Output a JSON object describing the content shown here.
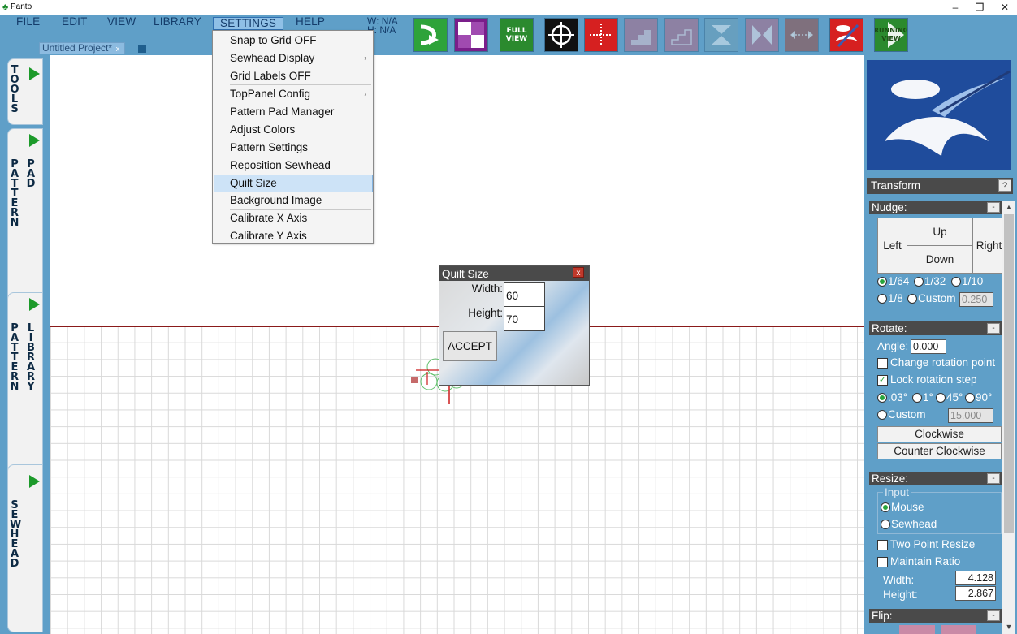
{
  "window": {
    "title": "Panto",
    "minimize": "–",
    "maximize": "❐",
    "close": "✕"
  },
  "menubar": {
    "file": "FILE",
    "edit": "EDIT",
    "view": "VIEW",
    "library": "LIBRARY",
    "settings": "SETTINGS",
    "help": "HELP"
  },
  "coords": {
    "w": "W: N/A",
    "h": "H: N/A"
  },
  "project": {
    "tab_label": "Untitled Project*",
    "tab_close": "x"
  },
  "toolbar": {
    "full_view": "FULL VIEW",
    "running_view": "RUNNING VIEW"
  },
  "sidebar": {
    "tools": "TOOLS",
    "pattern_pad_1": "PATTERN",
    "pattern_pad_2": "PAD",
    "pattern_library_1": "PATTERN",
    "pattern_library_2": "LIBRARY",
    "sewhead": "SEWHEAD"
  },
  "settings_menu": {
    "items": [
      "Snap to Grid OFF",
      "Sewhead Display",
      "Grid Labels OFF",
      "TopPanel Config",
      "Pattern Pad Manager",
      "Adjust Colors",
      "Pattern Settings",
      "Reposition Sewhead",
      "Quilt Size",
      "Background Image",
      "Calibrate X Axis",
      "Calibrate Y Axis"
    ],
    "submenu_arrow": "›"
  },
  "quilt_dialog": {
    "title": "Quilt Size",
    "close": "x",
    "width_label": "Width:",
    "width_value": "60",
    "height_label": "Height:",
    "height_value": "70",
    "accept": "ACCEPT"
  },
  "transform": {
    "title": "Transform",
    "help": "?",
    "nudge": {
      "title": "Nudge:",
      "collapse": "-",
      "up": "Up",
      "down": "Down",
      "left": "Left",
      "right": "Right",
      "opt_1_64": "1/64",
      "opt_1_32": "1/32",
      "opt_1_10": "1/10",
      "opt_1_8": "1/8",
      "opt_custom": "Custom",
      "custom_value": "0.250"
    },
    "rotate": {
      "title": "Rotate:",
      "collapse": "-",
      "angle_label": "Angle:",
      "angle_value": "0.000",
      "change_point": "Change rotation point",
      "lock_step": "Lock rotation step",
      "opt_03": ".03°",
      "opt_1": "1°",
      "opt_45": "45°",
      "opt_90": "90°",
      "opt_custom": "Custom",
      "custom_value": "15.000",
      "clockwise": "Clockwise",
      "counter_clockwise": "Counter Clockwise"
    },
    "resize": {
      "title": "Resize:",
      "collapse": "-",
      "input_group": "Input",
      "mouse": "Mouse",
      "sewhead": "Sewhead",
      "two_point": "Two Point Resize",
      "maintain_ratio": "Maintain Ratio",
      "width_label": "Width:",
      "width_value": "4.128",
      "height_label": "Height:",
      "height_value": "2.867"
    },
    "flip": {
      "title": "Flip:",
      "collapse": "-"
    }
  },
  "colors": {
    "panel": "#5f9fc8",
    "header": "#4a4a4a",
    "grid_border": "#8a1a1a",
    "accent_green": "#27a53a"
  }
}
